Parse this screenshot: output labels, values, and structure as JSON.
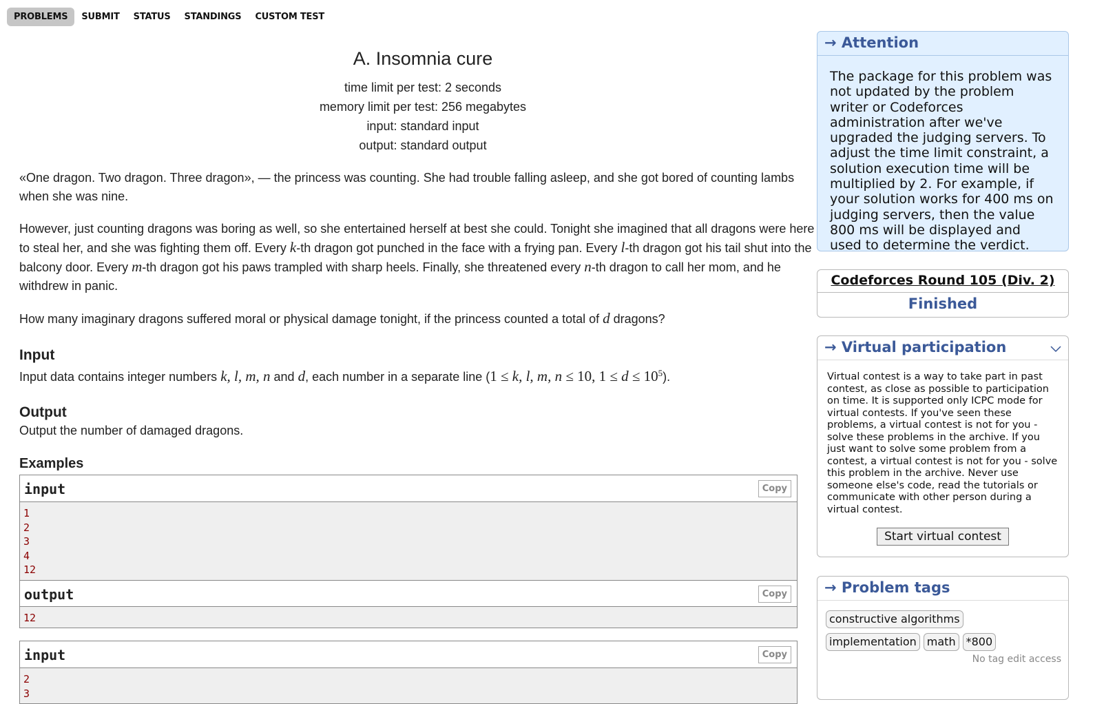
{
  "nav": {
    "tabs": [
      "PROBLEMS",
      "SUBMIT",
      "STATUS",
      "STANDINGS",
      "CUSTOM TEST"
    ],
    "active": "PROBLEMS"
  },
  "problem": {
    "title": "A. Insomnia cure",
    "time_limit": "time limit per test: 2 seconds",
    "memory_limit": "memory limit per test: 256 megabytes",
    "input_src": "input: standard input",
    "output_src": "output: standard output",
    "p1": "«One dragon. Two dragon. Three dragon», — the princess was counting. She had trouble falling asleep, and she got bored of counting lambs when she was nine.",
    "p2": {
      "a": "However, just counting dragons was boring as well, so she entertained herself at best she could. Tonight she imagined that all dragons were here to steal her, and she was fighting them off. Every ",
      "k": "k",
      "b": "-th dragon got punched in the face with a frying pan. Every ",
      "l": "l",
      "c": "-th dragon got his tail shut into the balcony door. Every ",
      "m": "m",
      "d": "-th dragon got his paws trampled with sharp heels. Finally, she threatened every ",
      "n": "n",
      "e": "-th dragon to call her mom, and he withdrew in panic."
    },
    "p3": {
      "a": "How many imaginary dragons suffered moral or physical damage tonight, if the princess counted a total of ",
      "d": "d",
      "b": " dragons?"
    },
    "input_title": "Input",
    "input_text": {
      "a": "Input data contains integer numbers ",
      "vars": "k, l, m, n",
      "and": " and ",
      "d": "d",
      "b": ", each number in a separate line (",
      "c1": "1 ≤ ",
      "c2": "k, l, m, n",
      "c3": " ≤ 10,  1 ≤ ",
      "c4": "d",
      "c5": " ≤ 10",
      "sup": "5",
      "end": ")."
    },
    "output_title": "Output",
    "output_text": "Output the number of damaged dragons.",
    "examples_title": "Examples",
    "copy_label": "Copy",
    "examples": [
      {
        "label": "input",
        "lines": [
          "1",
          "2",
          "3",
          "4",
          "12"
        ]
      },
      {
        "label": "output",
        "lines": [
          "12"
        ]
      },
      {
        "label": "input",
        "lines": [
          "2",
          "3"
        ]
      }
    ]
  },
  "sidebar": {
    "attention": {
      "title": "→ Attention",
      "text": "The package for this problem was not updated by the problem writer or Codeforces administration after we've upgraded the judging servers. To adjust the time limit constraint, a solution execution time will be multiplied by 2. For example, if your solution works for 400 ms on judging servers, then the value 800 ms will be displayed and used to determine the verdict."
    },
    "round": {
      "name": "Codeforces Round 105 (Div. 2)",
      "status": "Finished"
    },
    "virtual": {
      "title": "→ Virtual participation",
      "text": "Virtual contest is a way to take part in past contest, as close as possible to participation on time. It is supported only ICPC mode for virtual contests. If you've seen these problems, a virtual contest is not for you - solve these problems in the archive. If you just want to solve some problem from a contest, a virtual contest is not for you - solve this problem in the archive. Never use someone else's code, read the tutorials or communicate with other person during a virtual contest.",
      "button": "Start virtual contest"
    },
    "tags": {
      "title": "→ Problem tags",
      "items": [
        "constructive algorithms",
        "implementation",
        "math",
        "*800"
      ],
      "note": "No tag edit access"
    }
  },
  "colors": {
    "accent": "#3b5998",
    "attention_bg": "#e1f0ff",
    "sample_text": "#8b0000",
    "tab_active": "#c6c6c6"
  }
}
